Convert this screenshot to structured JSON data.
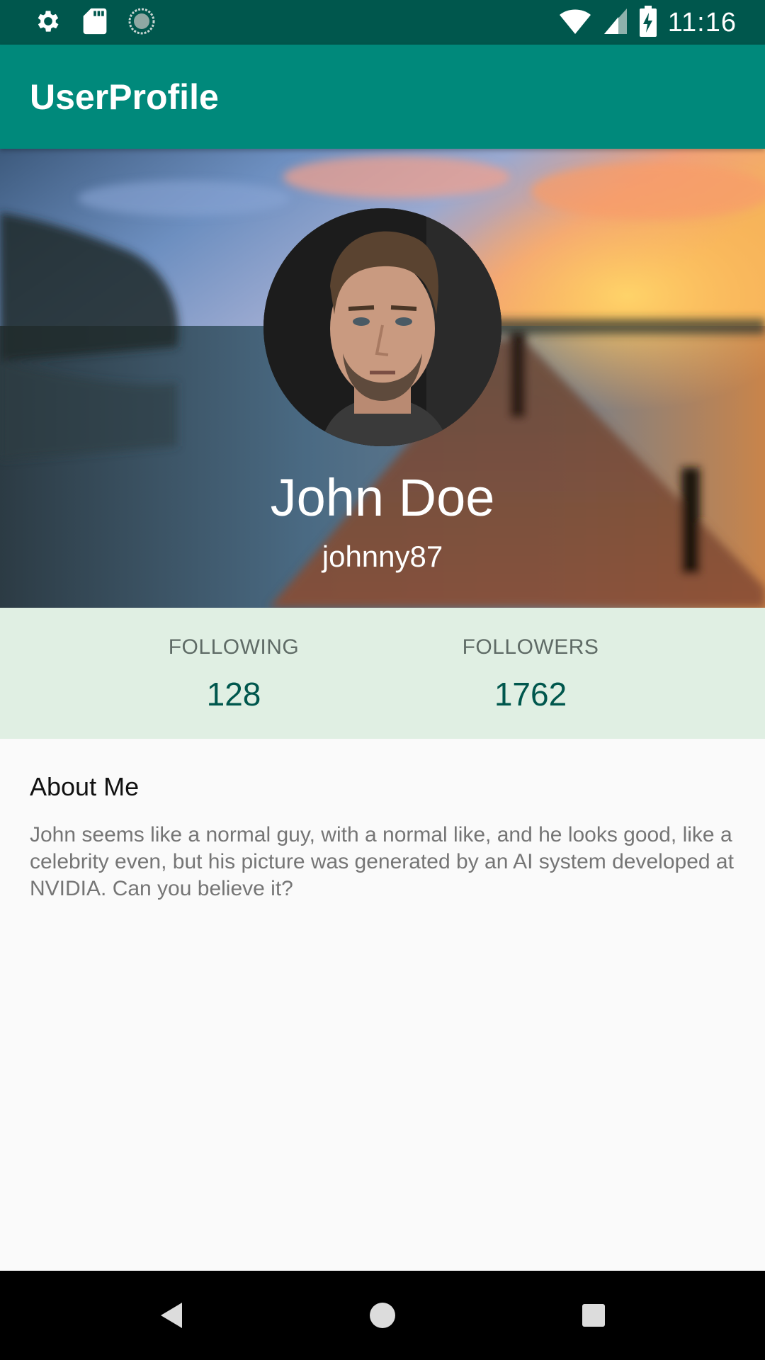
{
  "status_bar": {
    "time": "11:16",
    "left_icons": [
      "gear-icon",
      "sd-card-icon",
      "sync-icon"
    ],
    "right_icons": [
      "wifi-icon",
      "cell-signal-icon",
      "battery-charging-icon"
    ]
  },
  "app_bar": {
    "title": "UserProfile",
    "color": "#00897b"
  },
  "profile": {
    "name": "John Doe",
    "username": "johnny87"
  },
  "stats": {
    "following": {
      "label": "FOLLOWING",
      "value": "128"
    },
    "followers": {
      "label": "FOLLOWERS",
      "value": "1762"
    }
  },
  "about": {
    "title": "About Me",
    "body": "John seems like a normal guy, with a normal like, and he looks good, like a celebrity even, but his picture was generated by an AI system developed at NVIDIA. Can you believe it?"
  },
  "nav_bar": {
    "buttons": [
      "back-icon",
      "home-icon",
      "recents-icon"
    ]
  },
  "colors": {
    "status_bar": "#00574d",
    "app_bar": "#00897b",
    "stats_background": "#e0efe3",
    "stat_value": "#00574d"
  }
}
